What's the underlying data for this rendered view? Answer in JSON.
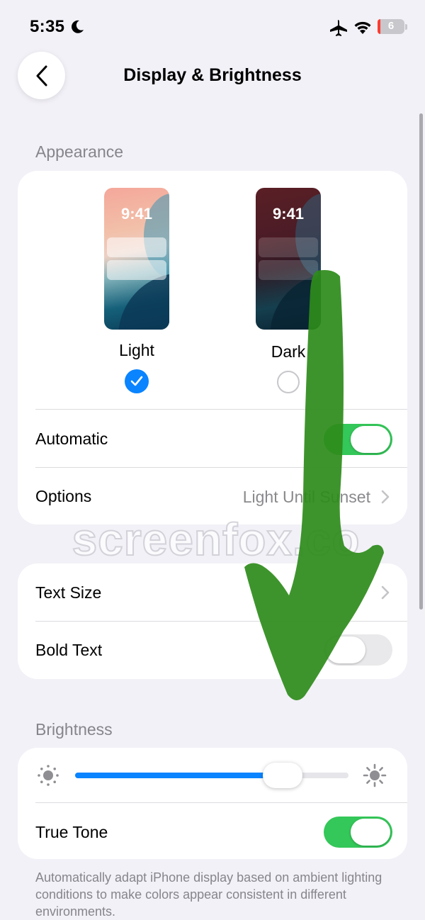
{
  "status_bar": {
    "time": "5:35",
    "battery_level": "6"
  },
  "nav": {
    "title": "Display & Brightness"
  },
  "appearance": {
    "header": "Appearance",
    "light": {
      "preview_time": "9:41",
      "label": "Light",
      "selected": true
    },
    "dark": {
      "preview_time": "9:41",
      "label": "Dark",
      "selected": false
    },
    "automatic": {
      "label": "Automatic",
      "on": true
    },
    "options": {
      "label": "Options",
      "value": "Light Until Sunset"
    }
  },
  "text": {
    "text_size": {
      "label": "Text Size"
    },
    "bold_text": {
      "label": "Bold Text",
      "on": false
    }
  },
  "brightness": {
    "header": "Brightness",
    "level": 0.76,
    "true_tone": {
      "label": "True Tone",
      "on": true
    },
    "footer": "Automatically adapt iPhone display based on ambient lighting conditions to make colors appear consistent in different environments."
  },
  "watermark": "screenfox.co",
  "colors": {
    "accent": "#0a84ff",
    "toggle_on": "#34c759",
    "background": "#f2f1f7",
    "annotation_arrow": "#2e8b1a"
  },
  "icons": [
    "moon-icon",
    "airplane-icon",
    "wifi-icon",
    "battery-icon",
    "back-chevron-icon",
    "checkmark-icon",
    "chevron-right-icon",
    "sun-dim-icon",
    "sun-bright-icon",
    "arrow-down-annotation"
  ]
}
